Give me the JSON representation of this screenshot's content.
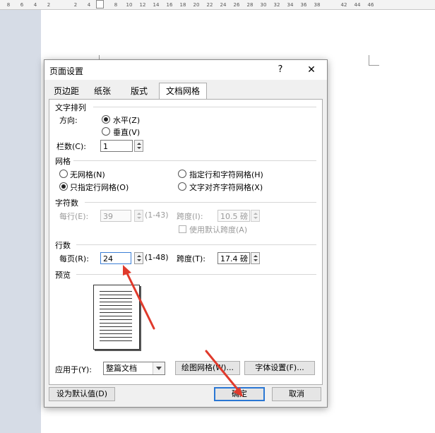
{
  "ruler": {
    "ticks": [
      "8",
      "6",
      "4",
      "2",
      "",
      "2",
      "4",
      "6",
      "8",
      "10",
      "12",
      "14",
      "16",
      "18",
      "20",
      "22",
      "24",
      "26",
      "28",
      "30",
      "32",
      "34",
      "36",
      "38",
      "",
      "42",
      "44",
      "46"
    ]
  },
  "dialog": {
    "title": "页面设置",
    "help_label": "?",
    "close_label": "✕",
    "tabs": [
      {
        "label": "页边距"
      },
      {
        "label": "纸张"
      },
      {
        "label": "版式"
      },
      {
        "label": "文档网格",
        "active": true
      }
    ],
    "text_direction": {
      "heading": "文字排列",
      "direction_label": "方向:",
      "horizontal_label": "水平(Z)",
      "vertical_label": "垂直(V)",
      "selected": "horizontal",
      "columns_label": "栏数(C):",
      "columns_value": "1"
    },
    "grid": {
      "heading": "网格",
      "options": [
        {
          "label": "无网格(N)",
          "selected": false
        },
        {
          "label": "指定行和字符网格(H)",
          "selected": false
        },
        {
          "label": "只指定行网格(O)",
          "selected": true
        },
        {
          "label": "文字对齐字符网格(X)",
          "selected": false
        }
      ]
    },
    "characters": {
      "heading": "字符数",
      "per_line_label": "每行(E):",
      "per_line_value": "39",
      "per_line_range": "(1-43)",
      "pitch_label": "跨度(I):",
      "pitch_value": "10.5 磅",
      "default_pitch_label": "使用默认跨度(A)"
    },
    "lines": {
      "heading": "行数",
      "per_page_label": "每页(R):",
      "per_page_value": "24",
      "per_page_range": "(1-48)",
      "pitch_label": "跨度(T):",
      "pitch_value": "17.4 磅"
    },
    "preview": {
      "heading": "预览"
    },
    "apply_to_label": "应用于(Y):",
    "apply_to_value": "整篇文档",
    "draw_grid_button": "绘图网格(W)...",
    "font_settings_button": "字体设置(F)...",
    "set_default_button": "设为默认值(D)",
    "ok_button": "确定",
    "cancel_button": "取消"
  },
  "colors": {
    "annotation_arrow": "#e03a2c",
    "focus_border": "#2a77d4"
  }
}
